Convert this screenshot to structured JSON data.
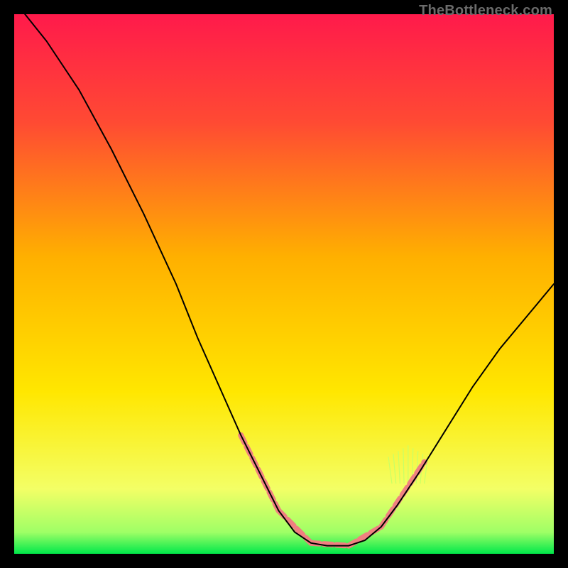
{
  "watermark": "TheBottleneck.com",
  "chart_data": {
    "type": "line",
    "title": "",
    "xlabel": "",
    "ylabel": "",
    "xlim": [
      0,
      100
    ],
    "ylim": [
      0,
      100
    ],
    "gradient_stops": [
      {
        "offset": 0.0,
        "color": "#ff1a4b"
      },
      {
        "offset": 0.2,
        "color": "#ff4a33"
      },
      {
        "offset": 0.45,
        "color": "#ffb000"
      },
      {
        "offset": 0.7,
        "color": "#ffe700"
      },
      {
        "offset": 0.88,
        "color": "#f3ff66"
      },
      {
        "offset": 0.96,
        "color": "#9fff66"
      },
      {
        "offset": 1.0,
        "color": "#00e84a"
      }
    ],
    "series": [
      {
        "name": "curve",
        "stroke": "#000000",
        "stroke_width": 2,
        "points": [
          {
            "x": 2,
            "y": 100
          },
          {
            "x": 6,
            "y": 95
          },
          {
            "x": 12,
            "y": 86
          },
          {
            "x": 18,
            "y": 75
          },
          {
            "x": 24,
            "y": 63
          },
          {
            "x": 30,
            "y": 50
          },
          {
            "x": 34,
            "y": 40
          },
          {
            "x": 38,
            "y": 31
          },
          {
            "x": 42,
            "y": 22
          },
          {
            "x": 46,
            "y": 14
          },
          {
            "x": 49,
            "y": 8
          },
          {
            "x": 52,
            "y": 4
          },
          {
            "x": 55,
            "y": 2
          },
          {
            "x": 58,
            "y": 1.5
          },
          {
            "x": 62,
            "y": 1.5
          },
          {
            "x": 65,
            "y": 2.5
          },
          {
            "x": 68,
            "y": 5
          },
          {
            "x": 71,
            "y": 9
          },
          {
            "x": 75,
            "y": 15
          },
          {
            "x": 80,
            "y": 23
          },
          {
            "x": 85,
            "y": 31
          },
          {
            "x": 90,
            "y": 38
          },
          {
            "x": 95,
            "y": 44
          },
          {
            "x": 100,
            "y": 50
          }
        ]
      }
    ],
    "highlight_segments": {
      "stroke": "#f08080",
      "stroke_width": 8,
      "dash": "12 6",
      "segments": [
        {
          "from": {
            "x": 42,
            "y": 22
          },
          "to": {
            "x": 49,
            "y": 8
          }
        },
        {
          "from": {
            "x": 49,
            "y": 8
          },
          "to": {
            "x": 55,
            "y": 2
          }
        },
        {
          "from": {
            "x": 55,
            "y": 2
          },
          "to": {
            "x": 62,
            "y": 1.5
          }
        },
        {
          "from": {
            "x": 62,
            "y": 1.5
          },
          "to": {
            "x": 68,
            "y": 5
          }
        },
        {
          "from": {
            "x": 68,
            "y": 5
          },
          "to": {
            "x": 72,
            "y": 11
          }
        },
        {
          "from": {
            "x": 72,
            "y": 11
          },
          "to": {
            "x": 76,
            "y": 17
          }
        }
      ]
    },
    "bristle": {
      "stroke": "#c8ff66",
      "center_x": 73,
      "base_y": 13,
      "count": 9,
      "spread": 6,
      "height": 18
    }
  }
}
